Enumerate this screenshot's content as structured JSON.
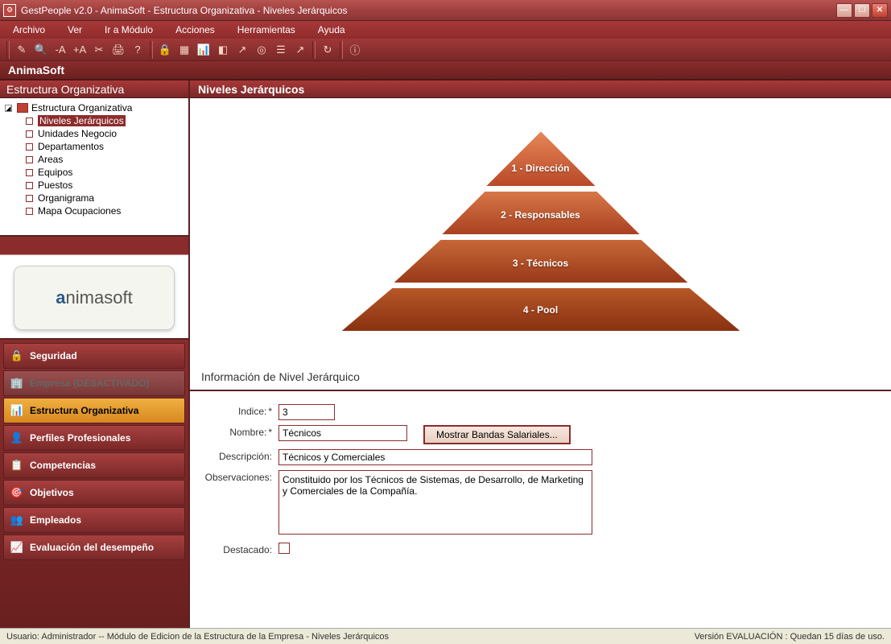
{
  "window": {
    "title": "GestPeople v2.0 - AnimaSoft - Estructura Organizativa - Niveles Jerárquicos"
  },
  "menu": {
    "archivo": "Archivo",
    "ver": "Ver",
    "ir_modulo": "Ir a Módulo",
    "acciones": "Acciones",
    "herramientas": "Herramientas",
    "ayuda": "Ayuda"
  },
  "app_subtitle": "AnimaSoft",
  "sidebar": {
    "header": "Estructura Organizativa",
    "root": "Estructura Organizativa",
    "items": [
      "Niveles Jerárquicos",
      "Unidades Negocio",
      "Departamentos",
      "Areas",
      "Equipos",
      "Puestos",
      "Organigrama",
      "Mapa Ocupaciones"
    ],
    "logo_a": "a",
    "logo_rest": "nimasoft"
  },
  "nav": [
    {
      "label": "Seguridad",
      "icon": "🔒"
    },
    {
      "label": "Empresa (DESACTIVADO)",
      "icon": "🏢"
    },
    {
      "label": "Estructura Organizativa",
      "icon": "📊"
    },
    {
      "label": "Perfiles Profesionales",
      "icon": "👤"
    },
    {
      "label": "Competencias",
      "icon": "📋"
    },
    {
      "label": "Objetivos",
      "icon": "🎯"
    },
    {
      "label": "Empleados",
      "icon": "👥"
    },
    {
      "label": "Evaluación del desempeño",
      "icon": "📈"
    }
  ],
  "content": {
    "header": "Niveles Jerárquicos",
    "pyramid": [
      "1 - Dirección",
      "2 - Responsables",
      "3 - Técnicos",
      "4 - Pool"
    ],
    "form_title": "Información de Nivel Jerárquico",
    "labels": {
      "indice": "Indice:",
      "nombre": "Nombre:",
      "descripcion": "Descripción:",
      "observaciones": "Observaciones:",
      "destacado": "Destacado:"
    },
    "values": {
      "indice": "3",
      "nombre": "Técnicos",
      "descripcion": "Técnicos y Comerciales",
      "observaciones": "Constituido por los Técnicos de Sistemas, de Desarrollo, de Marketing y Comerciales de la Compañía."
    },
    "bands_button": "Mostrar Bandas Salariales..."
  },
  "status": {
    "left": "Usuario: Administrador -- Módulo de Edicion de la Estructura de la Empresa  -  Niveles Jerárquicos",
    "right": "Versión EVALUACIÓN : Quedan 15 días de uso."
  }
}
